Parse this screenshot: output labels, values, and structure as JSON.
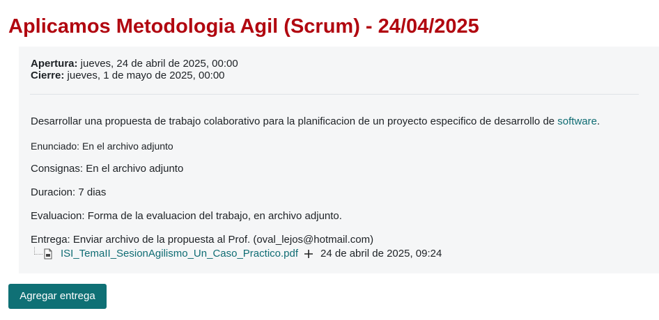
{
  "page": {
    "title": "Aplicamos Metodologia Agil (Scrum) - 24/04/2025"
  },
  "dates": {
    "opening_label": "Apertura:",
    "opening_value": " jueves, 24 de abril de 2025, 00:00",
    "closing_label": "Cierre:",
    "closing_value": " jueves, 1 de mayo de 2025, 00:00"
  },
  "description": {
    "intro_text": "Desarrollar una propuesta de trabajo colaborativo para la planificacion de un proyecto especifico de desarrollo de ",
    "intro_link": "software",
    "intro_end": ".",
    "enunciado": "Enunciado: En el archivo adjunto",
    "consignas": "Consignas: En el archivo adjunto",
    "duracion": "Duracion: 7 dias",
    "evaluacion": "Evaluacion: Forma de la evaluacion del trabajo, en archivo adjunto.",
    "entrega": "Entrega: Enviar archivo de la propuesta al Prof. (oval_lejos@hotmail.com)"
  },
  "attachment": {
    "file_name": "ISI_TemaII_SesionAgilismo_Un_Caso_Practico.pdf",
    "date": "24 de abril de 2025, 09:24",
    "icon": "pdf-file-icon"
  },
  "actions": {
    "add_submission_label": "Agregar entrega"
  },
  "colors": {
    "title": "#b10710",
    "link": "#0f6c73",
    "button": "#0f7075",
    "box_bg": "#f5f6f7"
  }
}
